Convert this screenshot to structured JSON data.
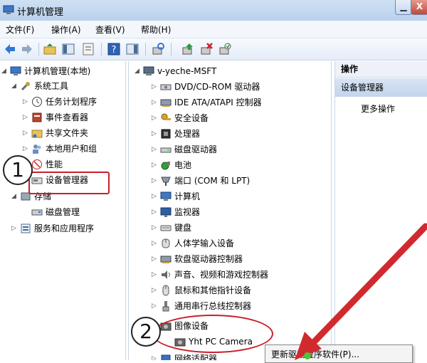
{
  "window": {
    "title": "计算机管理",
    "minimize_glyph": "▁",
    "close_glyph": "X"
  },
  "menu": [
    "文件(F)",
    "操作(A)",
    "查看(V)",
    "帮助(H)"
  ],
  "left_tree": [
    {
      "label": "计算机管理(本地)",
      "expand": "◢",
      "icon": "computer-manage-icon"
    },
    {
      "label": "系统工具",
      "expand": "◢",
      "icon": "tools-icon"
    },
    {
      "label": "任务计划程序",
      "expand": "▷",
      "icon": "clock-icon"
    },
    {
      "label": "事件查看器",
      "expand": "▷",
      "icon": "event-viewer-icon"
    },
    {
      "label": "共享文件夹",
      "expand": "▷",
      "icon": "shared-folder-icon"
    },
    {
      "label": "本地用户和组",
      "expand": "▷",
      "icon": "users-icon"
    },
    {
      "label": "性能",
      "expand": "▷",
      "icon": "performance-icon"
    },
    {
      "label": "设备管理器",
      "expand": "",
      "icon": "device-manager-icon"
    },
    {
      "label": "存储",
      "expand": "◢",
      "icon": "storage-icon"
    },
    {
      "label": "磁盘管理",
      "expand": "",
      "icon": "disk-icon"
    },
    {
      "label": "服务和应用程序",
      "expand": "▷",
      "icon": "services-icon"
    }
  ],
  "device_tree": {
    "root": "v-yeche-MSFT",
    "categories": [
      "DVD/CD-ROM 驱动器",
      "IDE ATA/ATAPI 控制器",
      "安全设备",
      "处理器",
      "磁盘驱动器",
      "电池",
      "端口 (COM 和 LPT)",
      "计算机",
      "监视器",
      "键盘",
      "人体学输入设备",
      "软盘驱动器控制器",
      "声音、视频和游戏控制器",
      "鼠标和其他指针设备",
      "通用串行总线控制器",
      "图像设备"
    ],
    "child": "Yht PC Camera",
    "partial": "网络适配器"
  },
  "actions": {
    "header": "操作",
    "section": "设备管理器",
    "more": "更多操作"
  },
  "annotations": {
    "step1": "1",
    "step2": "2"
  },
  "context_menu": {
    "item": "更新驱动程序软件(P)..."
  },
  "colors": {
    "accent_red": "#c8202a",
    "title_blue": "#b9d1ec"
  }
}
